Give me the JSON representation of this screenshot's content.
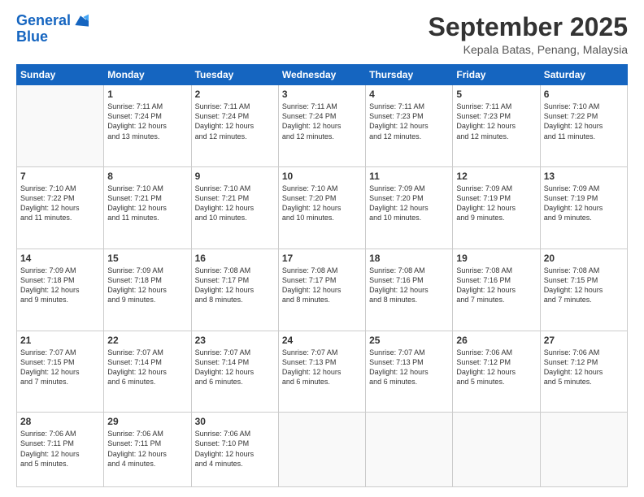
{
  "header": {
    "logo_line1": "General",
    "logo_line2": "Blue",
    "title": "September 2025",
    "location": "Kepala Batas, Penang, Malaysia"
  },
  "weekdays": [
    "Sunday",
    "Monday",
    "Tuesday",
    "Wednesday",
    "Thursday",
    "Friday",
    "Saturday"
  ],
  "weeks": [
    [
      {
        "day": "",
        "info": ""
      },
      {
        "day": "1",
        "info": "Sunrise: 7:11 AM\nSunset: 7:24 PM\nDaylight: 12 hours\nand 13 minutes."
      },
      {
        "day": "2",
        "info": "Sunrise: 7:11 AM\nSunset: 7:24 PM\nDaylight: 12 hours\nand 12 minutes."
      },
      {
        "day": "3",
        "info": "Sunrise: 7:11 AM\nSunset: 7:24 PM\nDaylight: 12 hours\nand 12 minutes."
      },
      {
        "day": "4",
        "info": "Sunrise: 7:11 AM\nSunset: 7:23 PM\nDaylight: 12 hours\nand 12 minutes."
      },
      {
        "day": "5",
        "info": "Sunrise: 7:11 AM\nSunset: 7:23 PM\nDaylight: 12 hours\nand 12 minutes."
      },
      {
        "day": "6",
        "info": "Sunrise: 7:10 AM\nSunset: 7:22 PM\nDaylight: 12 hours\nand 11 minutes."
      }
    ],
    [
      {
        "day": "7",
        "info": "Sunrise: 7:10 AM\nSunset: 7:22 PM\nDaylight: 12 hours\nand 11 minutes."
      },
      {
        "day": "8",
        "info": "Sunrise: 7:10 AM\nSunset: 7:21 PM\nDaylight: 12 hours\nand 11 minutes."
      },
      {
        "day": "9",
        "info": "Sunrise: 7:10 AM\nSunset: 7:21 PM\nDaylight: 12 hours\nand 10 minutes."
      },
      {
        "day": "10",
        "info": "Sunrise: 7:10 AM\nSunset: 7:20 PM\nDaylight: 12 hours\nand 10 minutes."
      },
      {
        "day": "11",
        "info": "Sunrise: 7:09 AM\nSunset: 7:20 PM\nDaylight: 12 hours\nand 10 minutes."
      },
      {
        "day": "12",
        "info": "Sunrise: 7:09 AM\nSunset: 7:19 PM\nDaylight: 12 hours\nand 9 minutes."
      },
      {
        "day": "13",
        "info": "Sunrise: 7:09 AM\nSunset: 7:19 PM\nDaylight: 12 hours\nand 9 minutes."
      }
    ],
    [
      {
        "day": "14",
        "info": "Sunrise: 7:09 AM\nSunset: 7:18 PM\nDaylight: 12 hours\nand 9 minutes."
      },
      {
        "day": "15",
        "info": "Sunrise: 7:09 AM\nSunset: 7:18 PM\nDaylight: 12 hours\nand 9 minutes."
      },
      {
        "day": "16",
        "info": "Sunrise: 7:08 AM\nSunset: 7:17 PM\nDaylight: 12 hours\nand 8 minutes."
      },
      {
        "day": "17",
        "info": "Sunrise: 7:08 AM\nSunset: 7:17 PM\nDaylight: 12 hours\nand 8 minutes."
      },
      {
        "day": "18",
        "info": "Sunrise: 7:08 AM\nSunset: 7:16 PM\nDaylight: 12 hours\nand 8 minutes."
      },
      {
        "day": "19",
        "info": "Sunrise: 7:08 AM\nSunset: 7:16 PM\nDaylight: 12 hours\nand 7 minutes."
      },
      {
        "day": "20",
        "info": "Sunrise: 7:08 AM\nSunset: 7:15 PM\nDaylight: 12 hours\nand 7 minutes."
      }
    ],
    [
      {
        "day": "21",
        "info": "Sunrise: 7:07 AM\nSunset: 7:15 PM\nDaylight: 12 hours\nand 7 minutes."
      },
      {
        "day": "22",
        "info": "Sunrise: 7:07 AM\nSunset: 7:14 PM\nDaylight: 12 hours\nand 6 minutes."
      },
      {
        "day": "23",
        "info": "Sunrise: 7:07 AM\nSunset: 7:14 PM\nDaylight: 12 hours\nand 6 minutes."
      },
      {
        "day": "24",
        "info": "Sunrise: 7:07 AM\nSunset: 7:13 PM\nDaylight: 12 hours\nand 6 minutes."
      },
      {
        "day": "25",
        "info": "Sunrise: 7:07 AM\nSunset: 7:13 PM\nDaylight: 12 hours\nand 6 minutes."
      },
      {
        "day": "26",
        "info": "Sunrise: 7:06 AM\nSunset: 7:12 PM\nDaylight: 12 hours\nand 5 minutes."
      },
      {
        "day": "27",
        "info": "Sunrise: 7:06 AM\nSunset: 7:12 PM\nDaylight: 12 hours\nand 5 minutes."
      }
    ],
    [
      {
        "day": "28",
        "info": "Sunrise: 7:06 AM\nSunset: 7:11 PM\nDaylight: 12 hours\nand 5 minutes."
      },
      {
        "day": "29",
        "info": "Sunrise: 7:06 AM\nSunset: 7:11 PM\nDaylight: 12 hours\nand 4 minutes."
      },
      {
        "day": "30",
        "info": "Sunrise: 7:06 AM\nSunset: 7:10 PM\nDaylight: 12 hours\nand 4 minutes."
      },
      {
        "day": "",
        "info": ""
      },
      {
        "day": "",
        "info": ""
      },
      {
        "day": "",
        "info": ""
      },
      {
        "day": "",
        "info": ""
      }
    ]
  ]
}
